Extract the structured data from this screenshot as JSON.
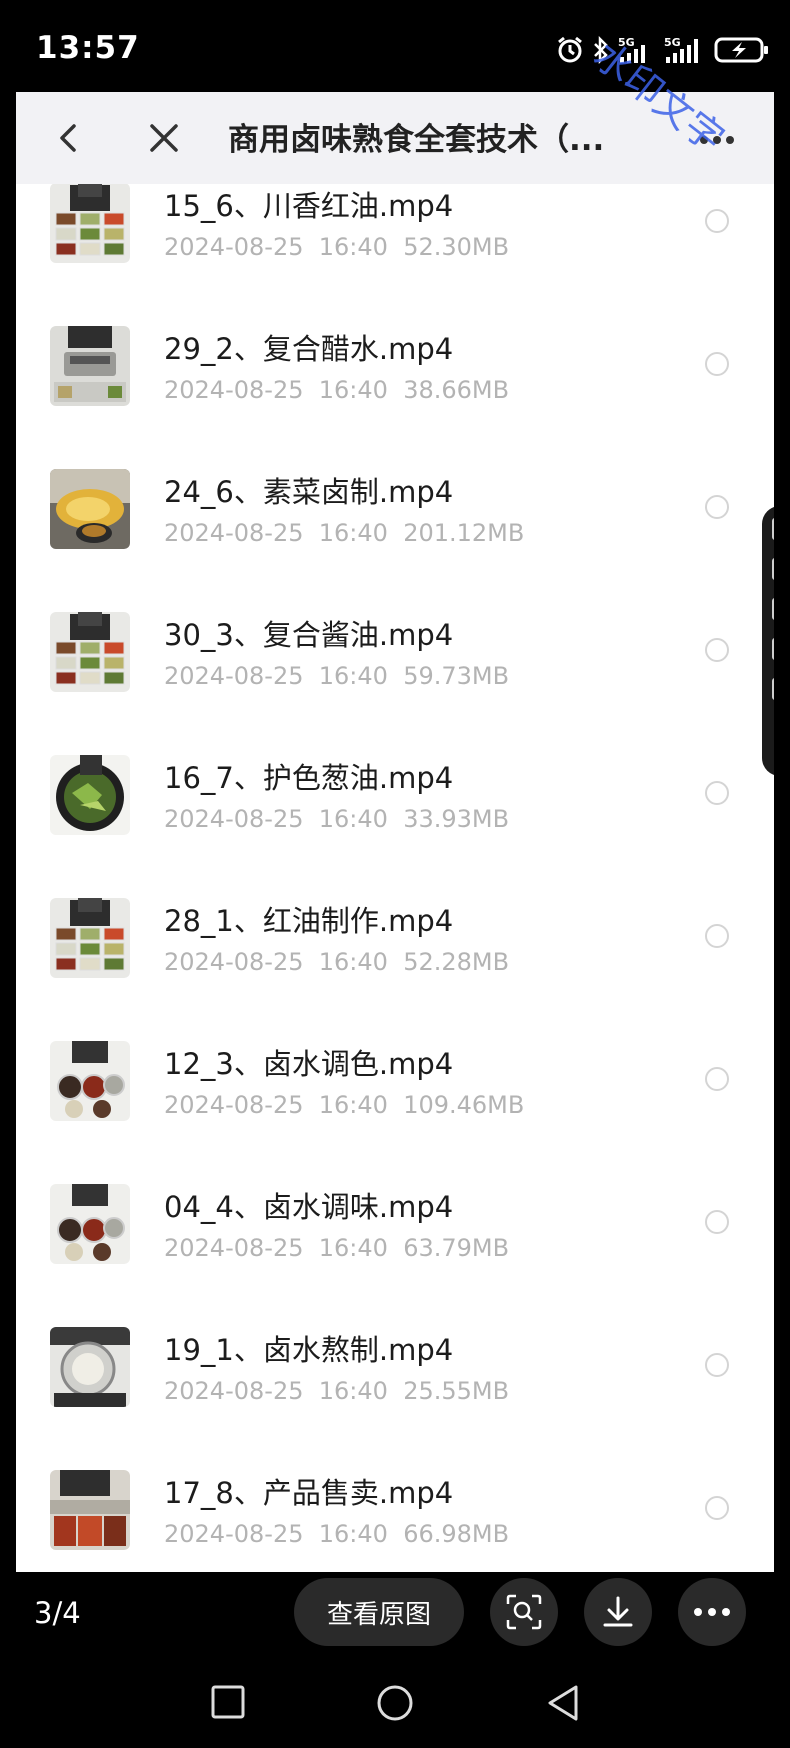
{
  "status_bar": {
    "time": "13:57",
    "icons": [
      "alarm-icon",
      "bluetooth-icon",
      "signal-5g-icon",
      "signal-5g-icon",
      "battery-charging-icon"
    ]
  },
  "header": {
    "back_icon": "chevron-left-icon",
    "close_icon": "close-icon",
    "title": "商用卤味熟食全套技术（...",
    "more_icon": "more-dots-icon"
  },
  "watermark": "水印文字",
  "files": [
    {
      "name": "15_6、川香红油.mp4",
      "date": "2024-08-25",
      "time": "16:40",
      "size": "52.30MB",
      "thumb": "ingredients"
    },
    {
      "name": "29_2、复合醋水.mp4",
      "date": "2024-08-25",
      "time": "16:40",
      "size": "38.66MB",
      "thumb": "machine"
    },
    {
      "name": "24_6、素菜卤制.mp4",
      "date": "2024-08-25",
      "time": "16:40",
      "size": "201.12MB",
      "thumb": "frying"
    },
    {
      "name": "30_3、复合酱油.mp4",
      "date": "2024-08-25",
      "time": "16:40",
      "size": "59.73MB",
      "thumb": "ingredients"
    },
    {
      "name": "16_7、护色葱油.mp4",
      "date": "2024-08-25",
      "time": "16:40",
      "size": "33.93MB",
      "thumb": "greens"
    },
    {
      "name": "28_1、红油制作.mp4",
      "date": "2024-08-25",
      "time": "16:40",
      "size": "52.28MB",
      "thumb": "ingredients"
    },
    {
      "name": "12_3、卤水调色.mp4",
      "date": "2024-08-25",
      "time": "16:40",
      "size": "109.46MB",
      "thumb": "bowls"
    },
    {
      "name": "04_4、卤水调味.mp4",
      "date": "2024-08-25",
      "time": "16:40",
      "size": "63.79MB",
      "thumb": "bowls"
    },
    {
      "name": "19_1、卤水熬制.mp4",
      "date": "2024-08-25",
      "time": "16:40",
      "size": "25.55MB",
      "thumb": "pot"
    },
    {
      "name": "17_8、产品售卖.mp4",
      "date": "2024-08-25",
      "time": "16:40",
      "size": "66.98MB",
      "thumb": "counter"
    }
  ],
  "viewer": {
    "counter": "3/4",
    "view_original": "查看原图",
    "actions": [
      "search-image-icon",
      "download-icon",
      "more-dots-icon"
    ]
  },
  "system_nav": [
    "recents-square-icon",
    "home-circle-icon",
    "back-triangle-icon"
  ]
}
